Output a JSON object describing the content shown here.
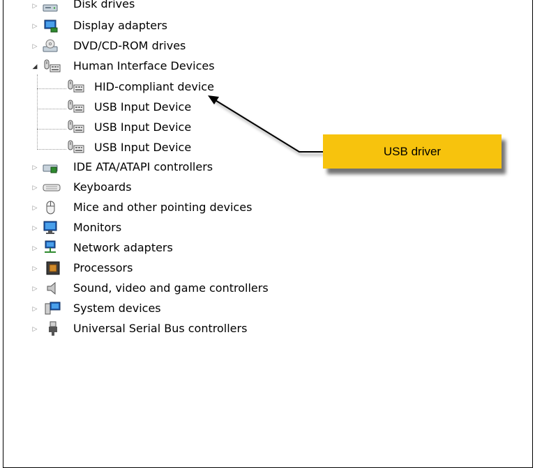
{
  "tree": {
    "items": [
      {
        "label": "Disk drives",
        "icon": "disk-drive-icon",
        "expander": "collapsed"
      },
      {
        "label": "Display adapters",
        "icon": "display-adapter-icon",
        "expander": "collapsed"
      },
      {
        "label": "DVD/CD-ROM drives",
        "icon": "dvd-drive-icon",
        "expander": "collapsed"
      },
      {
        "label": "Human Interface Devices",
        "icon": "hid-icon",
        "expander": "expanded"
      },
      {
        "label": "HID-compliant device",
        "icon": "hid-device-icon",
        "child": true
      },
      {
        "label": "USB Input Device",
        "icon": "usb-input-device-icon",
        "child": true
      },
      {
        "label": "USB Input Device",
        "icon": "usb-input-device-icon",
        "child": true
      },
      {
        "label": "USB Input Device",
        "icon": "usb-input-device-icon",
        "child": true
      },
      {
        "label": "IDE ATA/ATAPI controllers",
        "icon": "ide-controller-icon",
        "expander": "collapsed"
      },
      {
        "label": "Keyboards",
        "icon": "keyboard-icon",
        "expander": "collapsed"
      },
      {
        "label": "Mice and other pointing devices",
        "icon": "mouse-icon",
        "expander": "collapsed"
      },
      {
        "label": "Monitors",
        "icon": "monitor-icon",
        "expander": "collapsed"
      },
      {
        "label": "Network adapters",
        "icon": "network-adapter-icon",
        "expander": "collapsed"
      },
      {
        "label": "Processors",
        "icon": "processor-icon",
        "expander": "collapsed"
      },
      {
        "label": "Sound, video and game controllers",
        "icon": "speaker-icon",
        "expander": "collapsed"
      },
      {
        "label": "System devices",
        "icon": "system-device-icon",
        "expander": "collapsed"
      },
      {
        "label": "Universal Serial Bus controllers",
        "icon": "usb-plug-icon",
        "expander": "collapsed"
      }
    ]
  },
  "callout": {
    "label": "USB driver",
    "color": "#f7c30d"
  }
}
